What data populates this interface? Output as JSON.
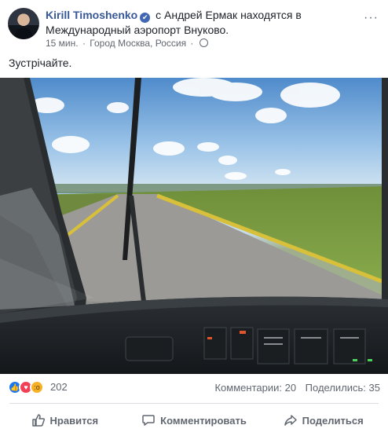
{
  "post": {
    "author": "Kirill Timoshenko",
    "verified_mark": "✔",
    "activity": "с Андрей Ермак находятся в Международный аэропорт Внуково.",
    "time": "15 мин.",
    "separator": "·",
    "location": "Город Москва, Россия",
    "privacy_icon": "globe-icon",
    "more_label": "···",
    "text": "Зустрічайте."
  },
  "photo": {
    "subject": "cockpit-runway-view",
    "colors": {
      "sky": "#6fa4d8",
      "grass": "#7c9a3c",
      "runway": "#9a9894",
      "line": "#e2c53a",
      "dash": "#1f2326"
    }
  },
  "reactions": {
    "icons": [
      "like-icon",
      "love-icon",
      "wow-icon"
    ],
    "like_glyph": "👍",
    "love_glyph": "♥",
    "wow_glyph": "😮",
    "count": "202"
  },
  "stats": {
    "comments": "Комментарии: 20",
    "shares": "Поделились: 35"
  },
  "actions": {
    "like": "Нравится",
    "comment": "Комментировать",
    "share": "Поделиться"
  },
  "colors": {
    "link": "#385898",
    "muted": "#606770",
    "brand": "#4267b2"
  }
}
